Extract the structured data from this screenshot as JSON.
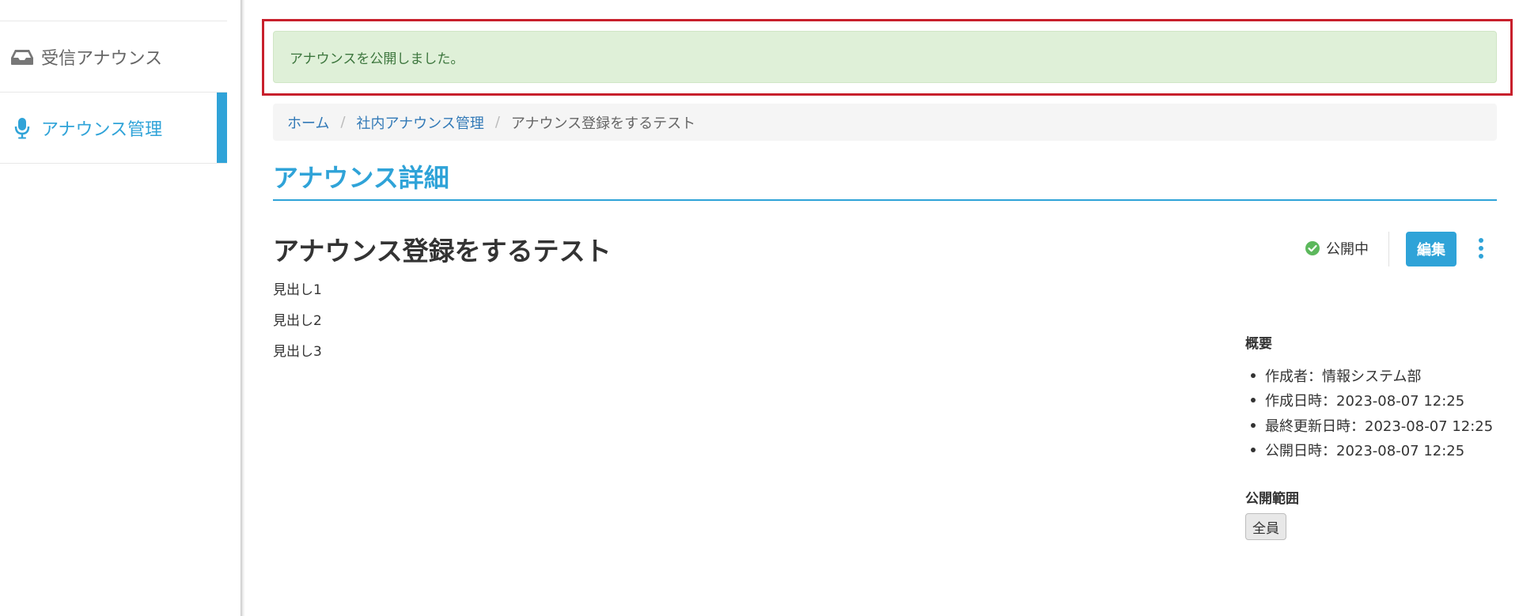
{
  "sidebar": {
    "items": [
      {
        "label": "受信アナウンス",
        "icon": "inbox-icon"
      },
      {
        "label": "アナウンス管理",
        "icon": "microphone-icon",
        "active": true
      }
    ]
  },
  "alert": {
    "message": "アナウンスを公開しました。"
  },
  "breadcrumb": {
    "items": [
      "ホーム",
      "社内アナウンス管理",
      "アナウンス登録をするテスト"
    ]
  },
  "page": {
    "title": "アナウンス詳細"
  },
  "announcement": {
    "title": "アナウンス登録をするテスト",
    "status": "公開中",
    "edit_label": "編集",
    "body": [
      "見出し1",
      "見出し2",
      "見出し3"
    ]
  },
  "summary": {
    "heading": "概要",
    "items": [
      "作成者：情報システム部",
      "作成日時：2023-08-07 12:25",
      "最終更新日時：2023-08-07 12:25",
      "公開日時：2023-08-07 12:25"
    ]
  },
  "scope": {
    "heading": "公開範囲",
    "value": "全員"
  },
  "colors": {
    "accent": "#2fa3d8",
    "success_bg": "#dff0d8",
    "success_text": "#3c763d",
    "highlight_frame": "#c8202c",
    "status_ok": "#5cb85c"
  }
}
